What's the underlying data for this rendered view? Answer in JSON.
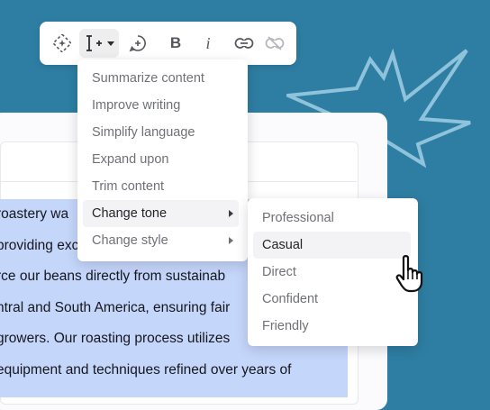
{
  "toolbar": {
    "buttons": [
      {
        "icon": "ai-sparkle-icon"
      },
      {
        "icon": "text-cursor-plus-icon"
      },
      {
        "icon": "comment-plus-icon"
      },
      {
        "icon": "bold-icon",
        "label": "B"
      },
      {
        "icon": "italic-icon",
        "label": "i"
      },
      {
        "icon": "link-icon"
      },
      {
        "icon": "unlink-icon"
      }
    ]
  },
  "ai_menu": {
    "items": [
      {
        "label": "Summarize content"
      },
      {
        "label": "Improve writing"
      },
      {
        "label": "Simplify language"
      },
      {
        "label": "Expand upon"
      },
      {
        "label": "Trim content"
      },
      {
        "label": "Change tone",
        "submenu": true,
        "highlighted": true
      },
      {
        "label": "Change style",
        "submenu": true
      }
    ]
  },
  "tone_menu": {
    "items": [
      {
        "label": "Professional"
      },
      {
        "label": "Casual",
        "highlighted": true
      },
      {
        "label": "Direct"
      },
      {
        "label": "Confident"
      },
      {
        "label": "Friendly"
      }
    ]
  },
  "editor": {
    "lines": [
      " roastery wa",
      "providing exc",
      "rce our beans directly from sustainab",
      "ntral and South America, ensuring fair",
      "growers. Our roasting process utilizes",
      "equipment and techniques refined over years of"
    ]
  },
  "colors": {
    "background": "#2e7ea3",
    "selection": "#c5d6fb",
    "accent_burst": "#8fc3dc"
  }
}
